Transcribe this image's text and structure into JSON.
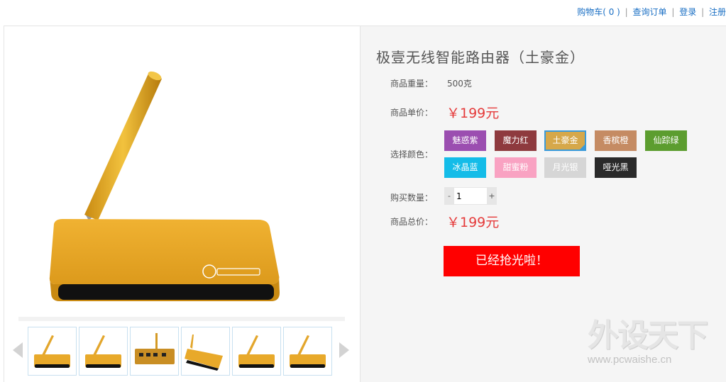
{
  "topnav": {
    "cart": "购物车( 0 )",
    "sep1": "|",
    "orders": "查询订单",
    "sep2": "|",
    "login": "登录",
    "sep3": "|",
    "register": "注册"
  },
  "product": {
    "title": "极壹无线智能路由器（土豪金）",
    "weight_label": "商品重量：",
    "weight_value": "500克",
    "price_label": "商品单价：",
    "price_value": "￥199元",
    "color_label": "选择颜色：",
    "colors": [
      {
        "name": "魅惑紫",
        "hex": "#9b4eb0"
      },
      {
        "name": "魔力红",
        "hex": "#8e3a3e"
      },
      {
        "name": "土豪金",
        "hex": "#d6a84a"
      },
      {
        "name": "香槟橙",
        "hex": "#c58b63"
      },
      {
        "name": "仙踪绿",
        "hex": "#5c9d2f"
      },
      {
        "name": "冰晶蓝",
        "hex": "#14bce8"
      },
      {
        "name": "甜蜜粉",
        "hex": "#f9a2c2"
      },
      {
        "name": "月光银",
        "hex": "#d6d6d6"
      },
      {
        "name": "哑光黑",
        "hex": "#2a2a2a"
      }
    ],
    "selected_color": "土豪金",
    "qty_label": "购买数量：",
    "qty_minus": "-",
    "qty_value": "1",
    "qty_plus": "+",
    "total_label": "商品总价：",
    "total_value": "￥199元",
    "soldout_button": "已经抢光啦！"
  },
  "gallery": {
    "thumbnail_count": 6,
    "prev_icon": "chevron-left-icon",
    "next_icon": "chevron-right-icon"
  },
  "watermark": {
    "logo": "外设天下",
    "url": "www.pcwaishe.cn"
  },
  "colors": {
    "link": "#1a6fc4",
    "price": "#e53b3b",
    "soldout": "#ff0000",
    "panel_bg": "#f5f5f5",
    "router_gold": "#e3a62c"
  }
}
